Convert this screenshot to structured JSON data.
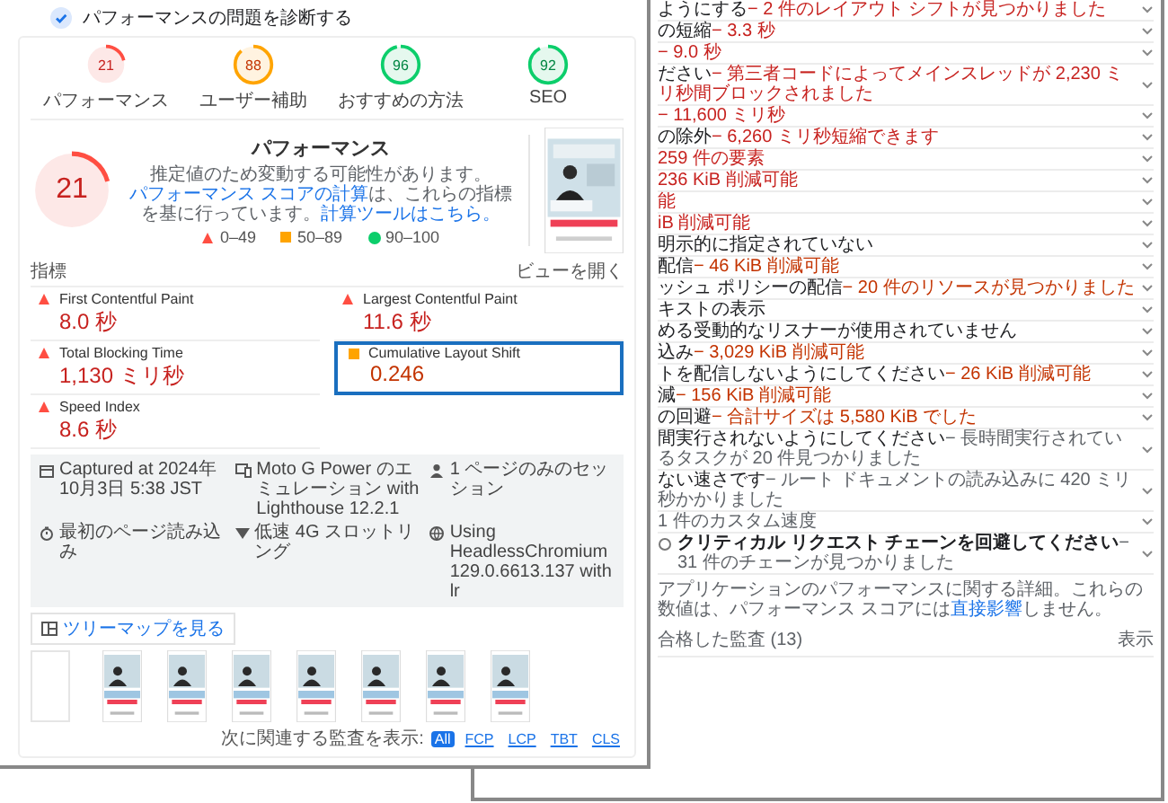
{
  "header": {
    "title": "パフォーマンスの問題を診断する"
  },
  "gauges": [
    {
      "score": "21",
      "label": "パフォーマンス",
      "kind": "fail"
    },
    {
      "score": "88",
      "label": "ユーザー補助",
      "kind": "average"
    },
    {
      "score": "96",
      "label": "おすすめの方法",
      "kind": "pass"
    },
    {
      "score": "92",
      "label": "SEO",
      "kind": "pass"
    }
  ],
  "performance": {
    "score": "21",
    "kind": "fail",
    "title": "パフォーマンス",
    "desc_1": "推定値のため変動する可能性があります。",
    "link_1": "パフォーマンス スコアの計算",
    "desc_2": "は、これらの指標を基に行っています。",
    "link_2": "計算ツールはこちら。",
    "legend": [
      {
        "kind": "fail",
        "label": "0–49"
      },
      {
        "kind": "average",
        "label": "50–89"
      },
      {
        "kind": "pass",
        "label": "90–100"
      }
    ]
  },
  "metrics": {
    "heading": "指標",
    "toggle": "ビューを開く",
    "items": [
      {
        "label": "First Contentful Paint",
        "value": "8.0 秒",
        "kind": "fail",
        "highlighted": false
      },
      {
        "label": "Largest Contentful Paint",
        "value": "11.6 秒",
        "kind": "fail",
        "highlighted": false
      },
      {
        "label": "Total Blocking Time",
        "value": "1,130 ミリ秒",
        "kind": "fail",
        "highlighted": false
      },
      {
        "label": "Cumulative Layout Shift",
        "value": "0.246",
        "kind": "average",
        "highlighted": true
      },
      {
        "label": "Speed Index",
        "value": "8.6 秒",
        "kind": "fail",
        "highlighted": false
      }
    ]
  },
  "info": [
    {
      "kind": "calendar",
      "text": "Captured at 2024年10月3日 5:38 JST"
    },
    {
      "kind": "device",
      "text": "Moto G Power のエミュレーション with Lighthouse 12.2.1"
    },
    {
      "kind": "person",
      "text": "1 ページのみのセッション"
    },
    {
      "kind": "timer",
      "text": "最初のページ読み込み"
    },
    {
      "kind": "signal",
      "text": "低速 4G スロットリング"
    },
    {
      "kind": "globe",
      "text": "Using HeadlessChromium 129.0.6613.137 with lr"
    }
  ],
  "treemap_button": "ツリーマップを見る",
  "filmstrip": [
    {
      "kind": "blank"
    },
    {
      "kind": "picture"
    },
    {
      "kind": "picture"
    },
    {
      "kind": "picture"
    },
    {
      "kind": "picture"
    },
    {
      "kind": "picture"
    },
    {
      "kind": "picture"
    },
    {
      "kind": "picture"
    }
  ],
  "audit_filter": {
    "label": "次に関連する監査を表示:",
    "chips": [
      {
        "label": "All",
        "selected": true
      },
      {
        "label": "FCP",
        "selected": false
      },
      {
        "label": "LCP",
        "selected": false
      },
      {
        "label": "TBT",
        "selected": false
      },
      {
        "label": "CLS",
        "selected": false
      }
    ]
  },
  "audits": {
    "rows": [
      {
        "title": "ようにする",
        "detail": "− 2 件のレイアウト シフトが見つかりました",
        "kind": "fail"
      },
      {
        "title": "の短縮",
        "detail": "− 3.3 秒",
        "kind": "fail"
      },
      {
        "detail": "− 9.0 秒",
        "kind": "fail"
      },
      {
        "title": "ださい",
        "detail": "− 第三者コードによってメインスレッドが 2,230 ミリ秒間ブロックされました",
        "kind": "fail"
      },
      {
        "detail": "− 11,600 ミリ秒",
        "kind": "fail"
      },
      {
        "title": "の除外",
        "detail": "− 6,260 ミリ秒短縮できます",
        "kind": "fail"
      },
      {
        "detail": "259 件の要素",
        "kind": "fail"
      },
      {
        "detail": "236 KiB 削減可能",
        "kind": "fail"
      },
      {
        "detail": "能",
        "kind": "fail"
      },
      {
        "detail": "iB 削減可能",
        "kind": "fail"
      },
      {
        "title": "明示的に指定されていない",
        "kind": "plain"
      },
      {
        "title": "配信",
        "detail": "− 46 KiB 削減可能",
        "kind": "average"
      },
      {
        "title": "ッシュ ポリシーの配信",
        "detail": "− 20 件のリソースが見つかりました",
        "kind": "average"
      },
      {
        "title": "キストの表示",
        "kind": "plain"
      },
      {
        "title": "める受動的なリスナーが使用されていません",
        "kind": "plain"
      },
      {
        "title": "込み",
        "detail": "− 3,029 KiB 削減可能",
        "kind": "average"
      },
      {
        "title": "トを配信しないようにしてください",
        "detail": "− 26 KiB 削減可能",
        "kind": "average"
      },
      {
        "title": "減",
        "detail": "− 156 KiB 削減可能",
        "kind": "average"
      },
      {
        "title": "の回避",
        "detail": "− 合計サイズは 5,580 KiB でした",
        "kind": "average"
      },
      {
        "title": "間実行されないようにしてください",
        "detail": "− 長時間実行されているタスクが 20 件見つかりました",
        "kind": "info"
      },
      {
        "title": "ない速さです",
        "detail": "− ルート ドキュメントの読み込みに 420 ミリ秒かかりました",
        "kind": "info"
      },
      {
        "detail": "1 件のカスタム速度",
        "kind": "info"
      },
      {
        "title": "クリティカル リクエスト チェーンを回避してください",
        "detail": "− 31 件のチェーンが見つかりました",
        "kind": "circle"
      }
    ],
    "note_before": "アプリケーションのパフォーマンスに関する詳細。これらの数値は、パフォーマンス スコアには",
    "note_link": "直接影響",
    "note_after": "しません。",
    "passed": {
      "label": "合格した監査 (13)",
      "toggle": "表示"
    }
  }
}
